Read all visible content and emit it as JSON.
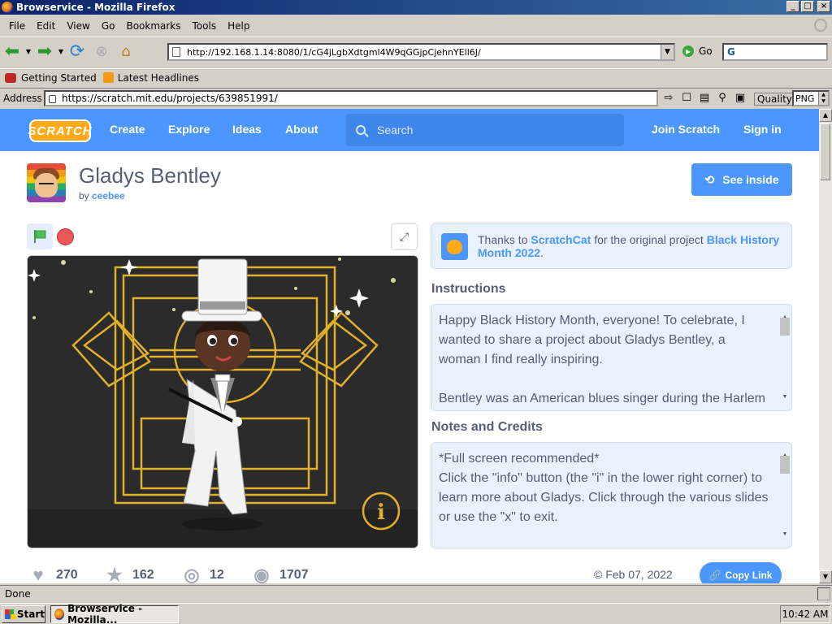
{
  "window": {
    "title": "Browservice - Mozilla Firefox",
    "buttons": {
      "minimize": "_",
      "maximize": "□",
      "close": "×"
    }
  },
  "menu": [
    "File",
    "Edit",
    "View",
    "Go",
    "Bookmarks",
    "Tools",
    "Help"
  ],
  "navbar": {
    "url": "http://192.168.1.14:8080/1/cG4jLgbXdtgml4W9qGGjpCjehnYEll6J/",
    "go_label": "Go",
    "search_value": "G"
  },
  "bookmarks": [
    "Getting Started",
    "Latest Headlines"
  ],
  "addressbar": {
    "label": "Address",
    "url": "https://scratch.mit.edu/projects/639851991/",
    "quality_label": "Quality",
    "quality_value": "PNG"
  },
  "scratch_nav": {
    "logo": "SCRATCH",
    "links": [
      "Create",
      "Explore",
      "Ideas",
      "About"
    ],
    "search_placeholder": "Search",
    "join": "Join Scratch",
    "signin": "Sign in"
  },
  "project": {
    "title": "Gladys Bentley",
    "by_prefix": "by",
    "author": "ceebee",
    "see_inside": "See inside"
  },
  "remix": {
    "prefix": "Thanks to",
    "user": "ScratchCat",
    "middle": "for the original project",
    "project": "Black History Month 2022",
    "suffix": "."
  },
  "instructions": {
    "title": "Instructions",
    "paragraphs": [
      "Happy Black History Month, everyone! To celebrate, I wanted to share a project about Gladys Bentley, a woman I find really inspiring.",
      "Bentley was an American blues singer during the Harlem"
    ]
  },
  "notes": {
    "title": "Notes and Credits",
    "lines": [
      "*Full screen recommended*",
      "Click the \"info\" button (the \"i\" in the lower right corner) to learn more about Gladys. Click through the various slides or use the \"x\" to exit."
    ]
  },
  "stats": {
    "loves": "270",
    "favorites": "162",
    "remixes": "12",
    "views": "1707"
  },
  "shared_date": "© Feb 07, 2022",
  "copy_link": "Copy Link",
  "status": "Done",
  "taskbar": {
    "start": "Start",
    "task": "Browservice - Mozilla...",
    "clock": "10:42 AM"
  },
  "colors": {
    "scratch_blue": "#4c97ff",
    "scratch_orange": "#ffab19",
    "text_gray": "#575e75",
    "stage_gold": "#e0b02a",
    "stage_bg": "#2b2b2b"
  }
}
